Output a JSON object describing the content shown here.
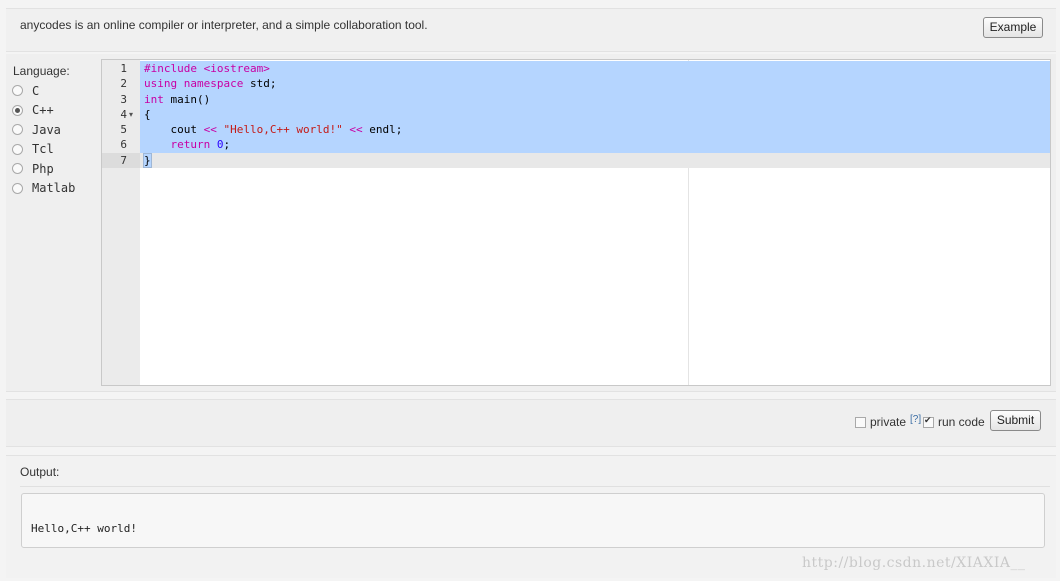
{
  "header": {
    "description": "anycodes is an online compiler or interpreter, and a simple collaboration tool.",
    "example_label": "Example"
  },
  "language": {
    "title": "Language:",
    "options": [
      {
        "label": "C",
        "selected": false
      },
      {
        "label": "C++",
        "selected": true
      },
      {
        "label": "Java",
        "selected": false
      },
      {
        "label": "Tcl",
        "selected": false
      },
      {
        "label": "Php",
        "selected": false
      },
      {
        "label": "Matlab",
        "selected": false
      }
    ]
  },
  "editor": {
    "lines": [
      {
        "num": "1",
        "text": "#include <iostream>"
      },
      {
        "num": "2",
        "text": "using namespace std;"
      },
      {
        "num": "3",
        "text": "int main()"
      },
      {
        "num": "4",
        "text": "{"
      },
      {
        "num": "5",
        "text": "    cout << \"Hello,C++ world!\" << endl;"
      },
      {
        "num": "6",
        "text": "    return 0;"
      },
      {
        "num": "7",
        "text": "}"
      }
    ]
  },
  "submit_bar": {
    "private_label": "private",
    "private_checked": false,
    "help_label": "[?]",
    "run_code_label": "run code",
    "run_code_checked": true,
    "submit_label": "Submit"
  },
  "output": {
    "label": "Output:",
    "text": "Hello,C++ world!"
  },
  "watermark": "http://blog.csdn.net/XIAXIA__"
}
